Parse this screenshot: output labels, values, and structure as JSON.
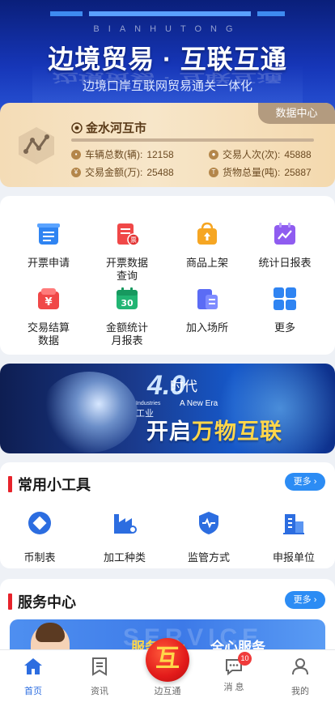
{
  "hero": {
    "brand_en": "BIANHUTONG",
    "title": "边境贸易 · 互联互通",
    "subtitle": "边境口岸互联网贸易通关一体化"
  },
  "data_card": {
    "tab_label": "数据中心",
    "location": "金水河互市",
    "stats": [
      {
        "label": "车辆总数(辆):",
        "value": "12158"
      },
      {
        "label": "交易人次(次):",
        "value": "45888"
      },
      {
        "label": "交易金额(万):",
        "value": "25488"
      },
      {
        "label": "货物总量(吨):",
        "value": "25887"
      }
    ]
  },
  "menu": [
    {
      "label": "开票申请",
      "icon": "invoice-icon",
      "color": "#2f84f2"
    },
    {
      "label": "开票数据\n查询",
      "icon": "invoice-query-icon",
      "color": "#f04848"
    },
    {
      "label": "商品上架",
      "icon": "shopping-bag-icon",
      "color": "#f6a623"
    },
    {
      "label": "统计日报表",
      "icon": "chart-calendar-icon",
      "color": "#8f5cf0"
    },
    {
      "label": "交易结算\n数据",
      "icon": "yen-wallet-icon",
      "color": "#f04848"
    },
    {
      "label": "金额统计\n月报表",
      "icon": "calendar-30-icon",
      "color": "#22b573"
    },
    {
      "label": "加入场所",
      "icon": "building-icon",
      "color": "#5b6cf5"
    },
    {
      "label": "更多",
      "icon": "grid-more-icon",
      "color": "#2f84f2"
    }
  ],
  "promo": {
    "number": "4.0",
    "era": "时代",
    "industry_cn": "工业",
    "industry_en": "Industries",
    "new_era_en": "A New Era",
    "tagline_prefix": "开启",
    "tagline_highlight": "万物互联"
  },
  "tools": {
    "title": "常用小工具",
    "more_label": "更多",
    "items": [
      {
        "label": "币制表",
        "icon": "currency-icon"
      },
      {
        "label": "加工种类",
        "icon": "factory-icon"
      },
      {
        "label": "监管方式",
        "icon": "shield-pulse-icon"
      },
      {
        "label": "申报单位",
        "icon": "office-building-icon"
      }
    ]
  },
  "service": {
    "title": "服务中心",
    "more_label": "更多",
    "banner_bg_word": "SERVICE",
    "banner_text_1": "服务中心",
    "banner_text_2": "全心服务"
  },
  "tabbar": {
    "items": [
      {
        "label": "首页",
        "icon": "home-icon",
        "active": true
      },
      {
        "label": "资讯",
        "icon": "bookmark-icon",
        "active": false
      },
      {
        "label": "边互通",
        "icon": "center-logo-icon",
        "active": false
      },
      {
        "label": "消 息",
        "icon": "message-icon",
        "active": false,
        "badge": "10"
      },
      {
        "label": "我的",
        "icon": "user-icon",
        "active": false
      }
    ],
    "center_glyph": "互"
  }
}
